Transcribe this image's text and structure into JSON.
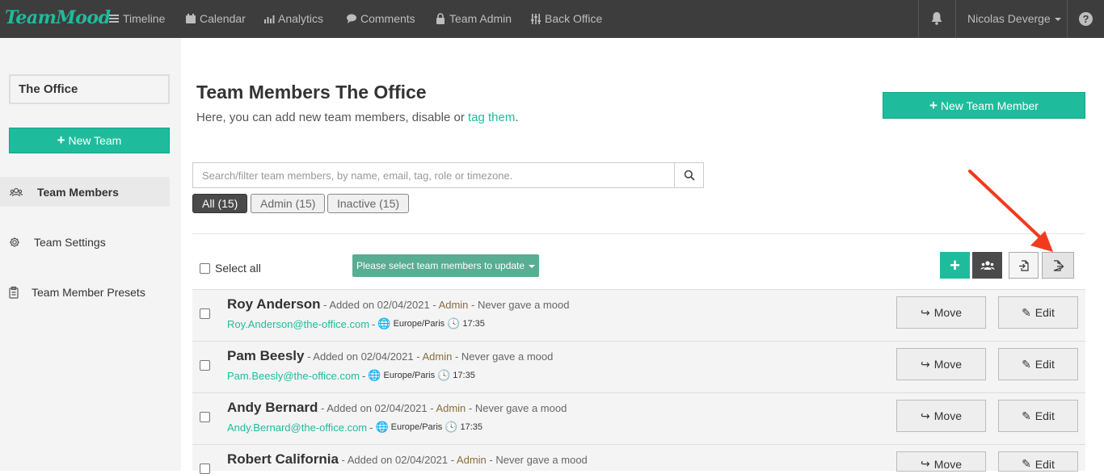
{
  "app": {
    "logo": "TeamMood"
  },
  "nav": {
    "items": [
      {
        "label": "Timeline",
        "icon": "list-icon"
      },
      {
        "label": "Calendar",
        "icon": "calendar-icon"
      },
      {
        "label": "Analytics",
        "icon": "chart-icon"
      },
      {
        "label": "Comments",
        "icon": "comment-icon"
      },
      {
        "label": "Team Admin",
        "icon": "lock-icon"
      },
      {
        "label": "Back Office",
        "icon": "sliders-icon"
      }
    ],
    "user": "Nicolas Deverge",
    "help": "?"
  },
  "sidebar": {
    "team_name": "The Office",
    "new_team_label": "New Team",
    "items": [
      {
        "label": "Team Members",
        "icon": "users-icon",
        "active": true
      },
      {
        "label": "Team Settings",
        "icon": "gear-icon"
      },
      {
        "label": "Team Member Presets",
        "icon": "clipboard-icon"
      }
    ]
  },
  "main": {
    "title": "Team Members The Office",
    "subtitle_prefix": "Here, you can add new team members, disable or ",
    "subtitle_link": "tag them",
    "subtitle_suffix": ".",
    "new_member_label": "New Team Member",
    "search_placeholder": "Search/filter team members, by name, email, tag, role or timezone.",
    "filters": [
      {
        "label": "All (15)",
        "active": true
      },
      {
        "label": "Admin (15)",
        "active": false
      },
      {
        "label": "Inactive (15)",
        "active": false
      }
    ],
    "select_all_label": "Select all",
    "bulk_update_label": "Please select team members to update",
    "tools": [
      "add-icon",
      "group-icon",
      "import-icon",
      "export-icon"
    ]
  },
  "members": [
    {
      "name": "Roy Anderson",
      "added": " - Added on 02/04/2021 - ",
      "role": "Admin",
      "mood": " - Never gave a mood",
      "email": "Roy.Anderson@the-office.com",
      "timezone": "Europe/Paris",
      "time": "17:35"
    },
    {
      "name": "Pam Beesly",
      "added": " - Added on 02/04/2021 - ",
      "role": "Admin",
      "mood": " - Never gave a mood",
      "email": "Pam.Beesly@the-office.com",
      "timezone": "Europe/Paris",
      "time": "17:35"
    },
    {
      "name": "Andy Bernard",
      "added": " - Added on 02/04/2021 - ",
      "role": "Admin",
      "mood": " - Never gave a mood",
      "email": "Andy.Bernard@the-office.com",
      "timezone": "Europe/Paris",
      "time": "17:35"
    },
    {
      "name": "Robert California",
      "added": " - Added on 02/04/2021 - ",
      "role": "Admin",
      "mood": " - Never gave a mood",
      "email": "",
      "timezone": "",
      "time": ""
    }
  ],
  "row_actions": {
    "move": "Move",
    "edit": "Edit"
  },
  "colors": {
    "accent": "#1ebc9c",
    "topbar": "#3d3d3d",
    "role": "#8a6d3b",
    "annotation_arrow": "#f23a1d"
  }
}
